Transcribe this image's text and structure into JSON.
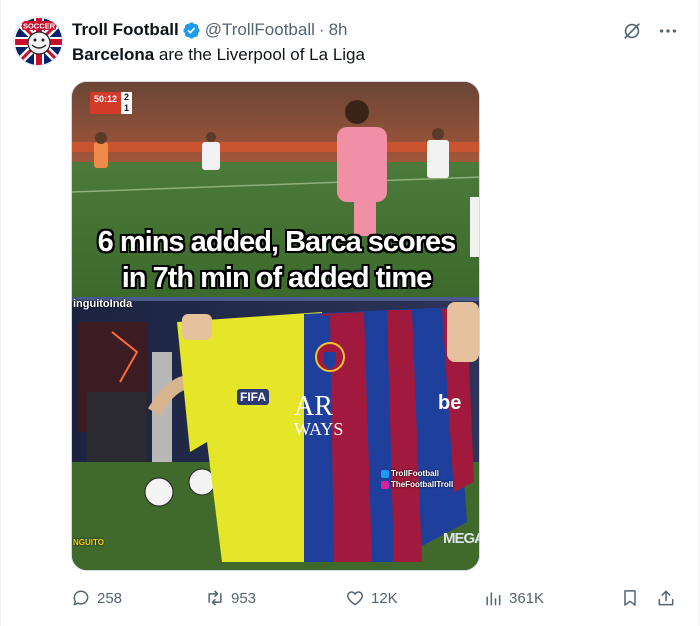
{
  "tweet": {
    "display_name": "Troll Football",
    "handle": "@TrollFootball",
    "separator": "·",
    "time": "8h",
    "text_bold": "Barcelona",
    "text_rest": " are the Liverpool of La Liga",
    "avatar_label": "SOCCER"
  },
  "media": {
    "caption_line1": "6 mins added, Barca scores",
    "caption_line2": "in 7th min of added time",
    "watermark_top": "inguitoInda",
    "jersey_sponsor_line1": "AR",
    "jersey_sponsor_line2": "WAYS",
    "jersey_sleeve": "be",
    "fifa_badge": "FIFA",
    "social_twitter": "TrollFootball",
    "social_instagram": "TheFootballTroll",
    "broadcaster": "MEGA",
    "show_logo": "NGUITO",
    "scoreboard": {
      "clock": "50:12",
      "home_score": "2",
      "away_score": "1"
    }
  },
  "actions": {
    "replies": "258",
    "retweets": "953",
    "likes": "12K",
    "views": "361K"
  },
  "colors": {
    "text_primary": "#0f1419",
    "text_secondary": "#536471",
    "verified": "#1d9bf0"
  },
  "icons": {
    "top": [
      "grok-icon",
      "more-icon"
    ],
    "actions": [
      "reply-icon",
      "retweet-icon",
      "like-icon",
      "views-icon",
      "bookmark-icon",
      "share-icon"
    ]
  }
}
